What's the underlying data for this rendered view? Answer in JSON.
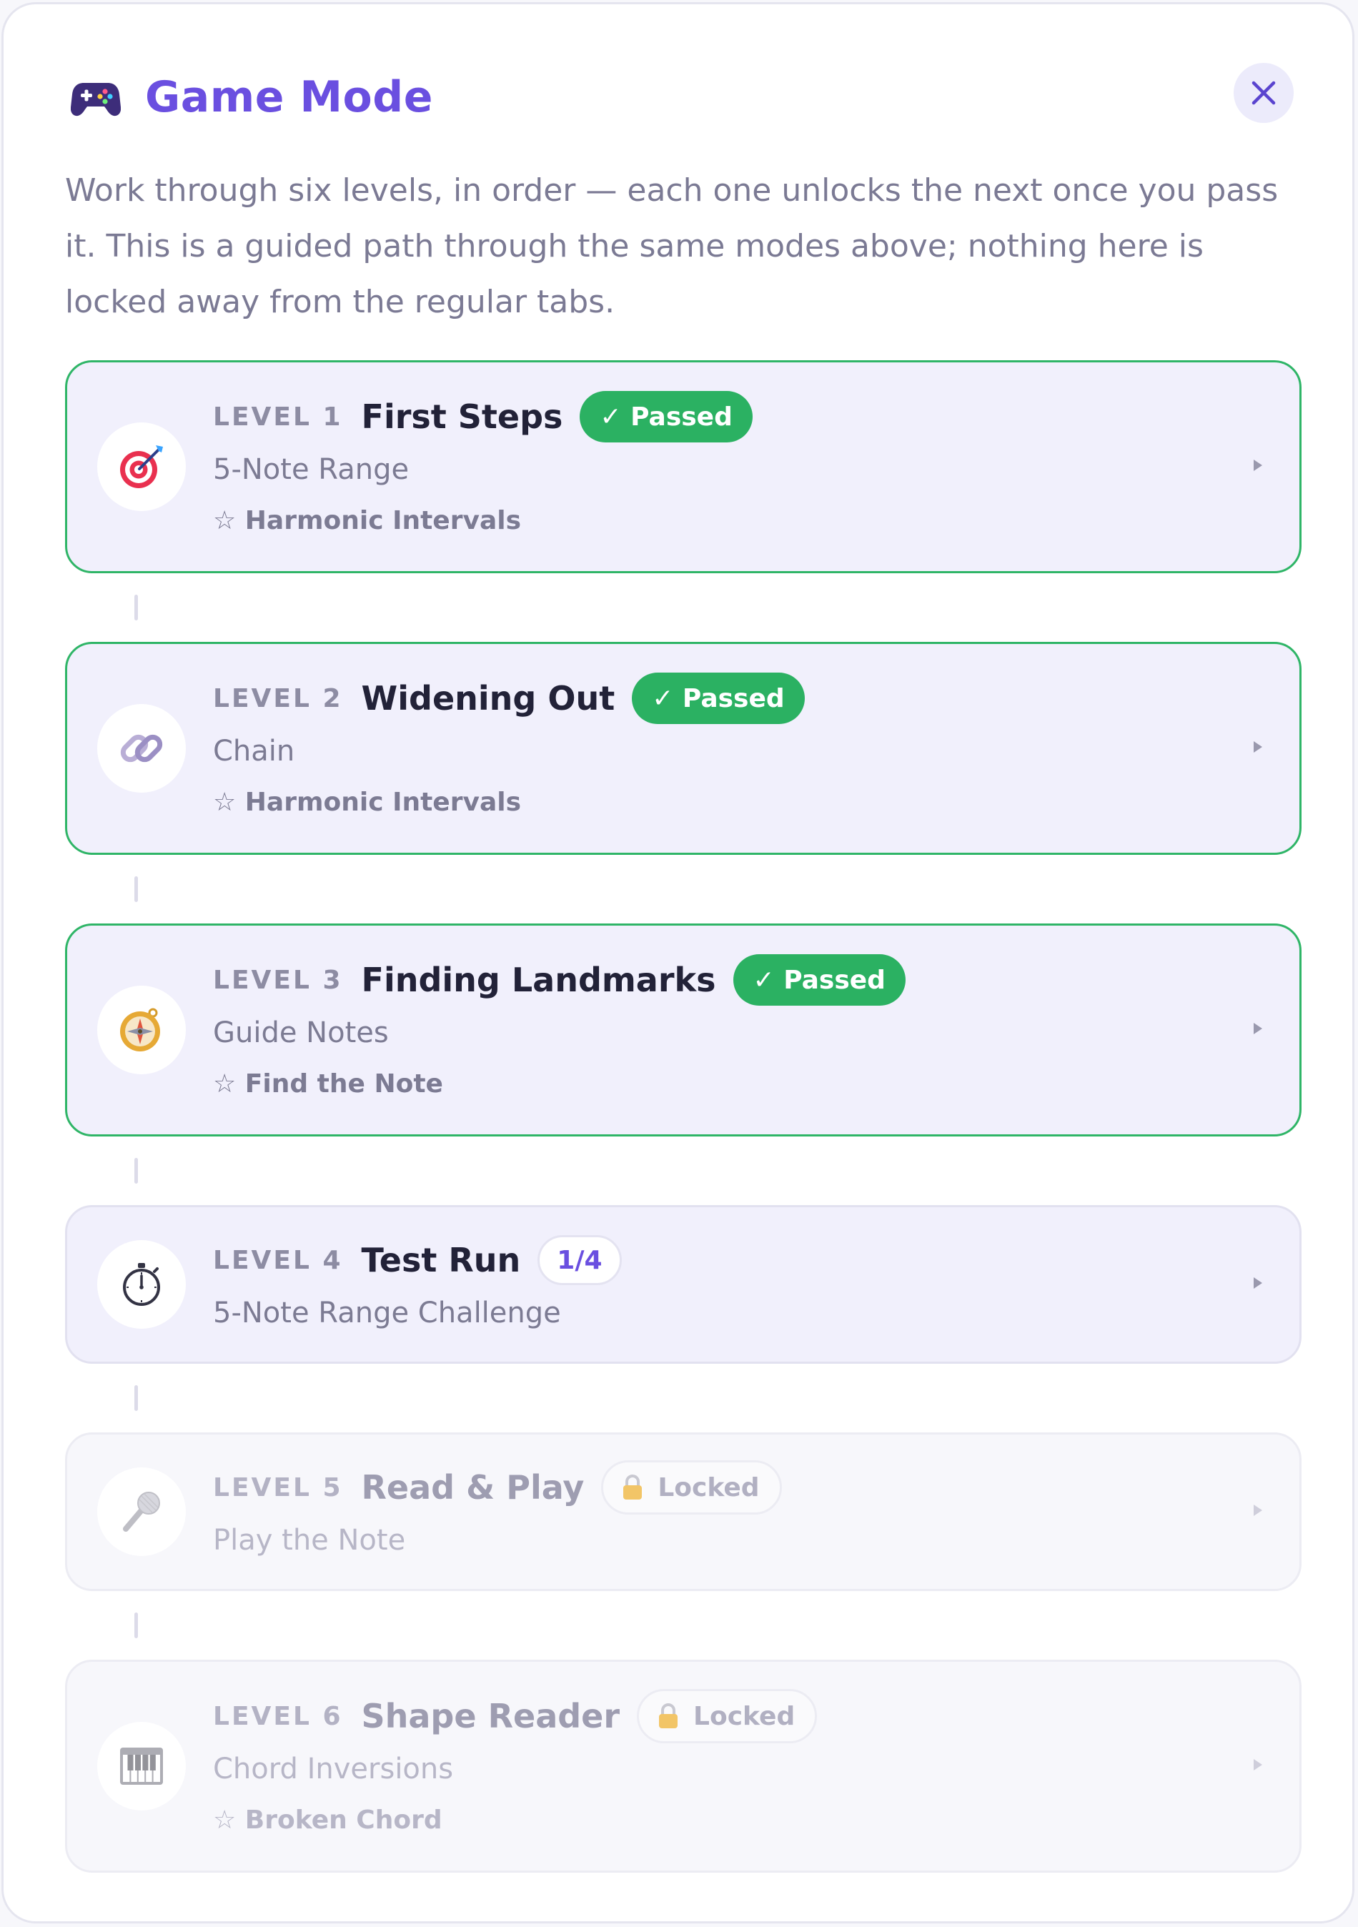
{
  "header": {
    "title": "Game Mode",
    "icon": "game-controller-icon",
    "close_icon": "close-icon"
  },
  "intro": "Work through six levels, in order — each one unlocks the next once you pass it. This is a guided path through the same modes above; nothing here is locked away from the regular tabs.",
  "colors": {
    "accent": "#6a4fe0",
    "passed": "#2bb162",
    "card_bg": "#f1f0fc"
  },
  "levels": [
    {
      "label": "LEVEL 1",
      "title": "First Steps",
      "status": "passed",
      "badge": "✓ Passed",
      "subtitle": "5-Note Range",
      "tag": "☆ Harmonic Intervals",
      "icon": "target-icon"
    },
    {
      "label": "LEVEL 2",
      "title": "Widening Out",
      "status": "passed",
      "badge": "✓ Passed",
      "subtitle": "Chain",
      "tag": "☆ Harmonic Intervals",
      "icon": "chain-link-icon"
    },
    {
      "label": "LEVEL 3",
      "title": "Finding Landmarks",
      "status": "passed",
      "badge": "✓ Passed",
      "subtitle": "Guide Notes",
      "tag": "☆ Find the Note",
      "icon": "compass-icon"
    },
    {
      "label": "LEVEL 4",
      "title": "Test Run",
      "status": "in-progress",
      "badge": "1/4",
      "subtitle": "5-Note Range Challenge",
      "tag": "",
      "icon": "stopwatch-icon"
    },
    {
      "label": "LEVEL 5",
      "title": "Read & Play",
      "status": "locked",
      "badge": "Locked",
      "subtitle": "Play the Note",
      "tag": "",
      "icon": "microphone-icon"
    },
    {
      "label": "LEVEL 6",
      "title": "Shape Reader",
      "status": "locked",
      "badge": "Locked",
      "subtitle": "Chord Inversions",
      "tag": "☆ Broken Chord",
      "icon": "piano-keys-icon"
    }
  ]
}
